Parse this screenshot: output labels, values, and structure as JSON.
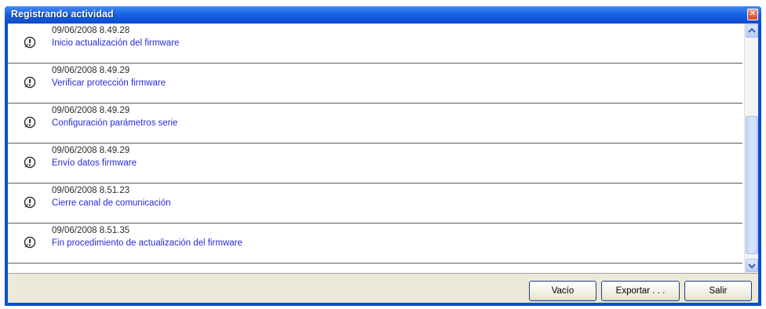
{
  "window": {
    "title": "Registrando actividad",
    "close_glyph": "✕"
  },
  "log": {
    "entries": [
      {
        "timestamp": "09/06/2008 8.49.28",
        "message": "Inicio actualización del firmware",
        "icon": "info-icon"
      },
      {
        "timestamp": "09/06/2008 8.49.29",
        "message": "Verificar protección firmware",
        "icon": "info-icon"
      },
      {
        "timestamp": "09/06/2008 8.49.29",
        "message": "Configuración parámetros serie",
        "icon": "info-icon"
      },
      {
        "timestamp": "09/06/2008 8.49.29",
        "message": "Envío datos firmware",
        "icon": "info-icon"
      },
      {
        "timestamp": "09/06/2008 8.51.23",
        "message": "Cierre canal de comunicación",
        "icon": "info-icon"
      },
      {
        "timestamp": "09/06/2008 8.51.35",
        "message": "Fin procedimiento de actualización del firmware",
        "icon": "info-icon"
      }
    ]
  },
  "buttons": {
    "vacio": "Vacío",
    "exportar": "Exportar . . .",
    "salir": "Salir"
  },
  "colors": {
    "title_bar": "#0a4fd2",
    "message_text": "#2929d6",
    "dialog_bg": "#ece9d8"
  }
}
